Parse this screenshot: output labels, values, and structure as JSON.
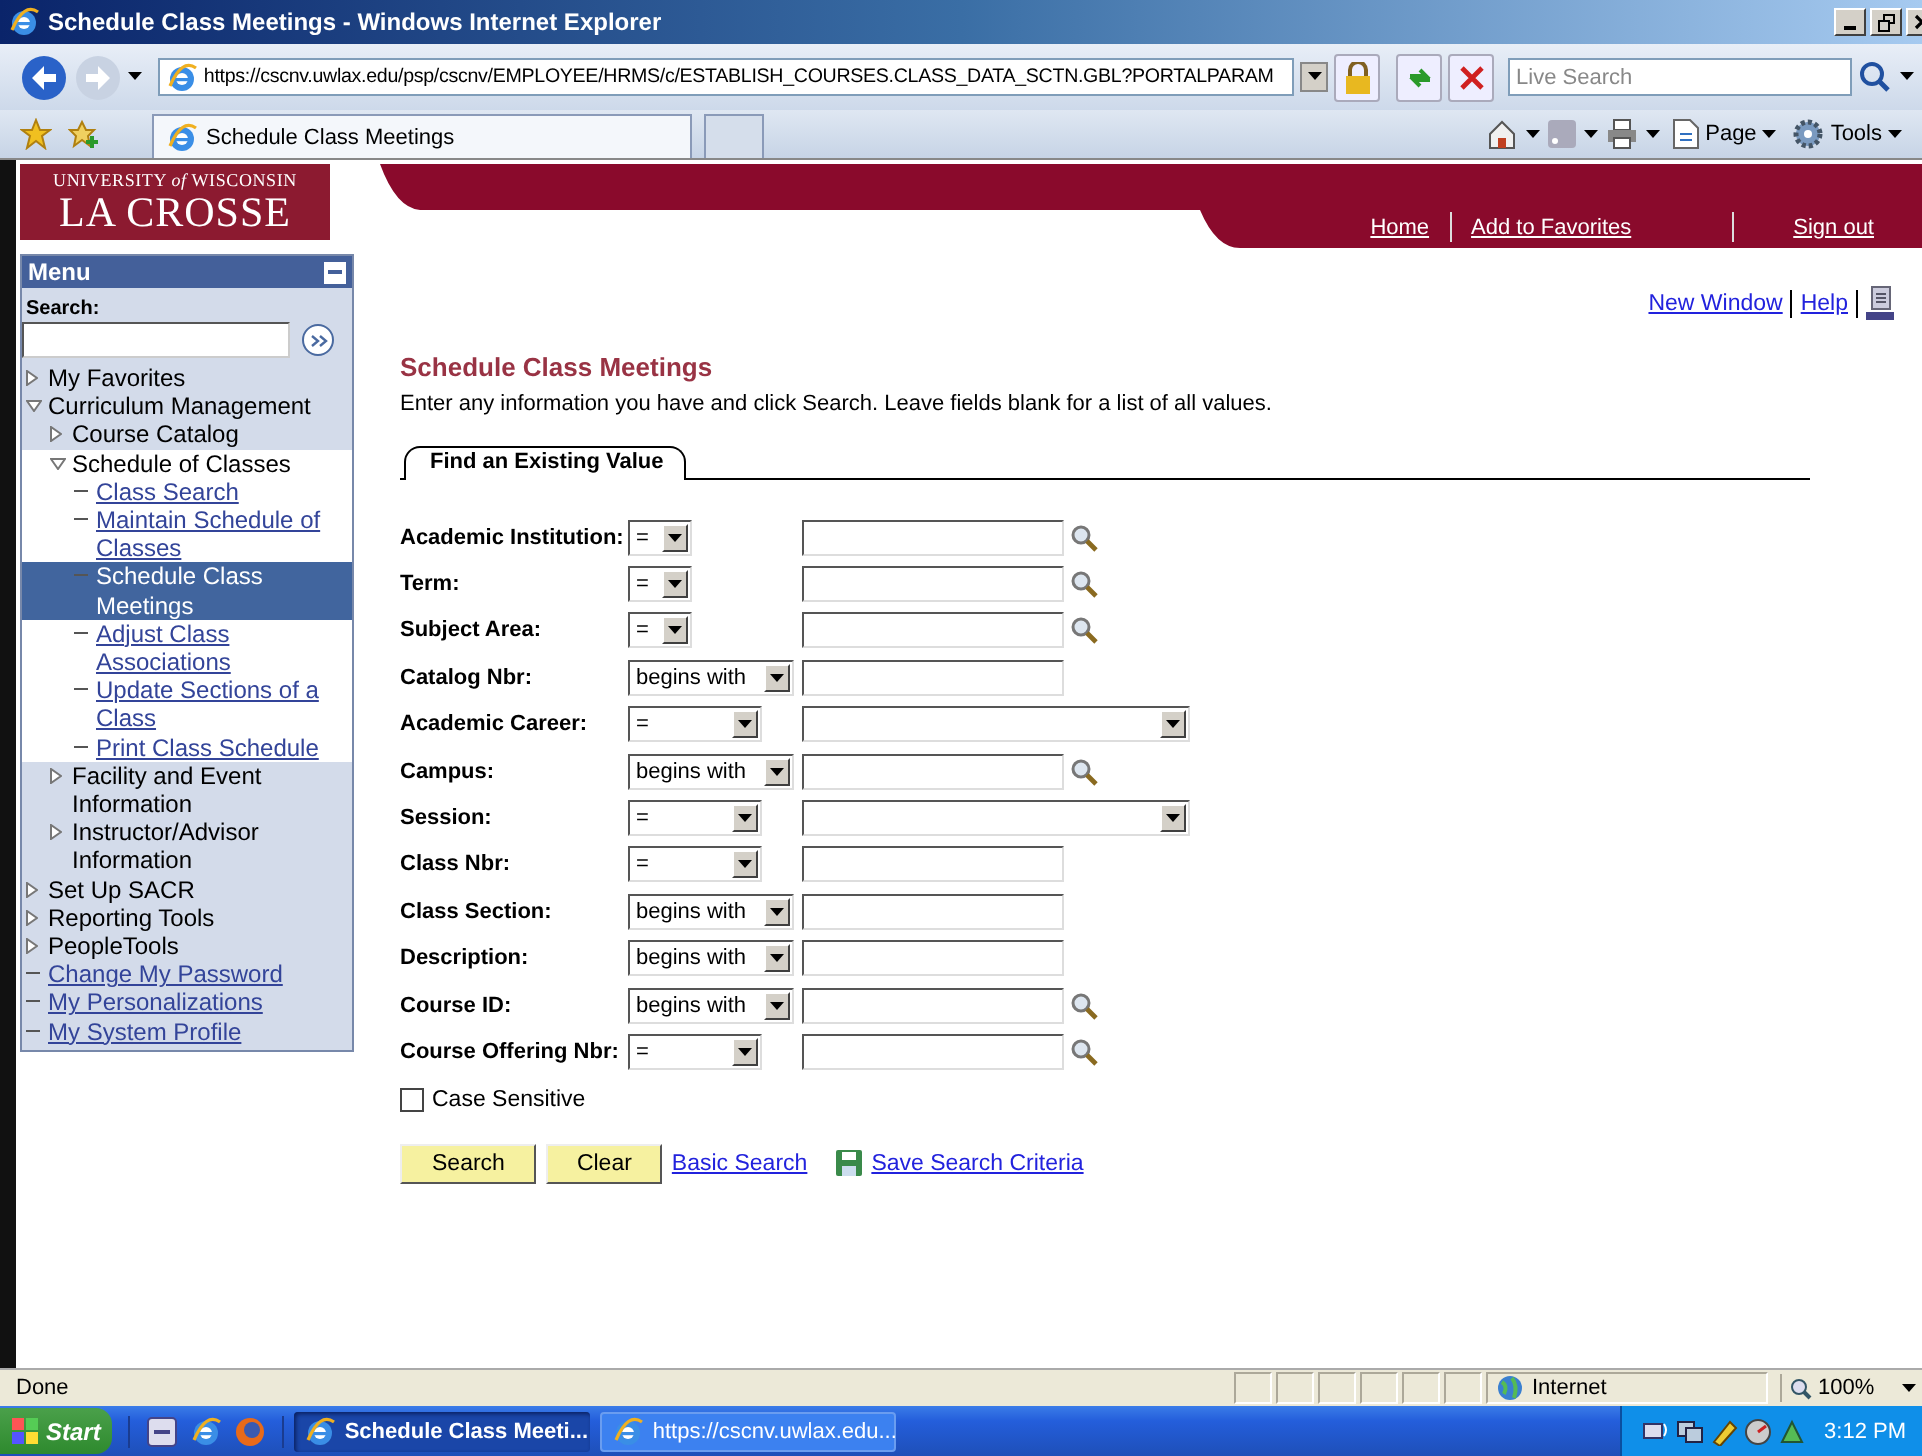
{
  "window": {
    "title": "Schedule Class Meetings - Windows Internet Explorer"
  },
  "browser": {
    "address": "https://cscnv.uwlax.edu/psp/cscnv/EMPLOYEE/HRMS/c/ESTABLISH_COURSES.CLASS_DATA_SCTN.GBL?PORTALPARAM",
    "search": {
      "placeholder": "Live Search"
    },
    "tabs": [
      {
        "label": "Schedule Class Meetings",
        "selected": true
      }
    ],
    "commands": [
      "Page",
      "Tools"
    ]
  },
  "header": {
    "logo": {
      "line_1": "UNIVERSITY *of* WISCONSIN",
      "line_2": "LA CROSSE"
    },
    "links": [
      "Home",
      "Add to Favorites",
      "Sign out"
    ]
  },
  "menu": {
    "title": "Menu",
    "search_label": "Search:",
    "items": [
      {
        "label": "My Favorites",
        "kind": "folder",
        "expanded": false,
        "selected": false
      },
      {
        "label": "Curriculum Management",
        "kind": "folder",
        "expanded": true,
        "selected": false,
        "children": [
          {
            "label": "Course Catalog",
            "kind": "folder",
            "expanded": false,
            "selected": false
          },
          {
            "label": "Schedule of Classes",
            "kind": "folder",
            "expanded": true,
            "selected": false,
            "children": [
              {
                "label": "Class Search",
                "kind": "link",
                "selected": false
              },
              {
                "label": "Maintain Schedule of Classes",
                "kind": "link",
                "selected": false
              },
              {
                "label": "Schedule Class Meetings",
                "kind": "link",
                "selected": true
              },
              {
                "label": "Adjust Class Associations",
                "kind": "link",
                "selected": false
              },
              {
                "label": "Update Sections of a Class",
                "kind": "link",
                "selected": false
              },
              {
                "label": "Print Class Schedule",
                "kind": "link",
                "selected": false
              }
            ]
          },
          {
            "label": "Facility and Event Information",
            "kind": "folder",
            "expanded": false,
            "selected": false
          },
          {
            "label": "Instructor/Advisor Information",
            "kind": "folder",
            "expanded": false,
            "selected": false
          }
        ]
      },
      {
        "label": "Set Up SACR",
        "kind": "folder",
        "expanded": false,
        "selected": false
      },
      {
        "label": "Reporting Tools",
        "kind": "folder",
        "expanded": false,
        "selected": false
      },
      {
        "label": "PeopleTools",
        "kind": "folder",
        "expanded": false,
        "selected": false
      },
      {
        "label": "Change My Password",
        "kind": "link",
        "selected": false
      },
      {
        "label": "My Personalizations",
        "kind": "link",
        "selected": false
      },
      {
        "label": "My System Profile",
        "kind": "link",
        "selected": false
      }
    ]
  },
  "page": {
    "links": [
      "New Window",
      "Help"
    ],
    "title": "Schedule Class Meetings",
    "instructions": "Enter any information you have and click Search. Leave fields blank for a list of all values.",
    "tabs": [
      {
        "label": "Find an Existing Value",
        "selected": true
      }
    ],
    "fields": [
      {
        "label": "Academic Institution:",
        "operator": {
          "value": "=",
          "kind": "short"
        },
        "kind": "lookup"
      },
      {
        "label": "Term:",
        "operator": {
          "value": "=",
          "kind": "short"
        },
        "kind": "lookup"
      },
      {
        "label": "Subject Area:",
        "operator": {
          "value": "=",
          "kind": "short"
        },
        "kind": "lookup"
      },
      {
        "label": "Catalog Nbr:",
        "operator": {
          "value": "begins with",
          "kind": "long"
        },
        "kind": "text"
      },
      {
        "label": "Academic Career:",
        "operator": {
          "value": "=",
          "kind": "long"
        },
        "kind": "dropdown"
      },
      {
        "label": "Campus:",
        "operator": {
          "value": "begins with",
          "kind": "long"
        },
        "kind": "lookup"
      },
      {
        "label": "Session:",
        "operator": {
          "value": "=",
          "kind": "long"
        },
        "kind": "dropdown"
      },
      {
        "label": "Class Nbr:",
        "operator": {
          "value": "=",
          "kind": "long"
        },
        "kind": "text"
      },
      {
        "label": "Class Section:",
        "operator": {
          "value": "begins with",
          "kind": "long"
        },
        "kind": "text"
      },
      {
        "label": "Description:",
        "operator": {
          "value": "begins with",
          "kind": "long"
        },
        "kind": "text"
      },
      {
        "label": "Course ID:",
        "operator": {
          "value": "begins with",
          "kind": "long"
        },
        "kind": "lookup"
      },
      {
        "label": "Course Offering Nbr:",
        "operator": {
          "value": "=",
          "kind": "long"
        },
        "kind": "lookup"
      }
    ],
    "case_sensitive": {
      "label": "Case Sensitive",
      "checked": false
    },
    "buttons": [
      "Search",
      "Clear"
    ],
    "links_after": [
      {
        "label": "Basic Search",
        "kind": "link"
      },
      {
        "label": "Save Search Criteria",
        "kind": "save"
      }
    ]
  },
  "status_bar": {
    "text": "Done",
    "zone": "Internet",
    "zoom": "100%"
  },
  "taskbar": {
    "start": "Start",
    "tasks": [
      {
        "label": "Schedule Class Meeti...",
        "selected": true
      },
      {
        "label": "https://cscnv.uwlax.edu...",
        "selected": false
      }
    ],
    "clock": "3:12 PM"
  }
}
